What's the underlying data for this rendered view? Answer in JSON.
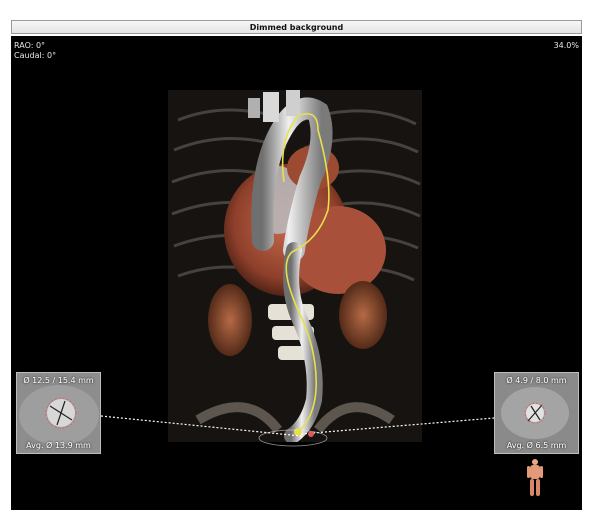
{
  "window": {
    "title": "Dimmed background"
  },
  "view": {
    "rao_label": "RAO: 0°",
    "caudal_label": "Caudal: 0°",
    "zoom_label": "34.0%"
  },
  "left_inset": {
    "diameters": "Ø 12.5 / 15.4 mm",
    "average": "Avg. Ø 13.9 mm"
  },
  "right_inset": {
    "diameters": "Ø 4.9 / 8.0 mm",
    "average": "Avg. Ø 6.5 mm"
  },
  "colors": {
    "centerline": "#e8e04a",
    "measurement": "#e05a5a",
    "tissue": "#b4563a"
  },
  "icons": {
    "orientation": "body-figure-icon"
  }
}
